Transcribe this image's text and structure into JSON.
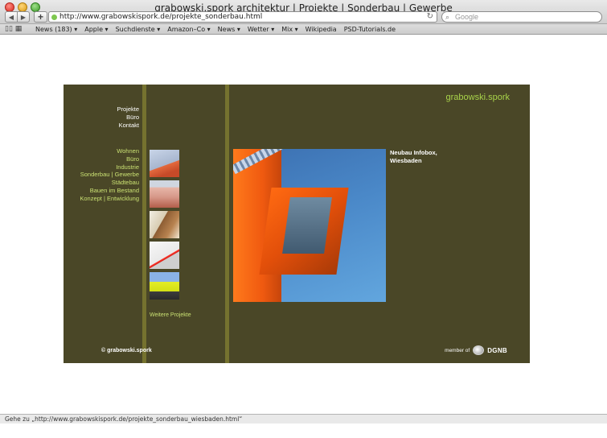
{
  "browser": {
    "window_title": "grabowski.spork architektur | Projekte | Sonderbau | Gewerbe",
    "url": "http://www.grabowskispork.de/projekte_sonderbau.html",
    "search_placeholder": "Google",
    "bookmarks": [
      "News (183) ▾",
      "Apple ▾",
      "Suchdienste ▾",
      "Amazon–Co ▾",
      "News ▾",
      "Wetter ▾",
      "Mix ▾",
      "Wikipedia",
      "PSD-Tutorials.de"
    ],
    "status_text": "Gehe zu „http://www.grabowskispork.de/projekte_sonderbau_wiesbaden.html“"
  },
  "site": {
    "logo": "grabowski.spork",
    "menu_main": [
      "Projekte",
      "Büro",
      "Kontakt"
    ],
    "menu_sub": [
      "Wohnen",
      "Büro",
      "Industrie",
      "Sonderbau | Gewerbe",
      "Städtebau",
      "Bauen im Bestand",
      "Konzept | Entwicklung"
    ],
    "more_projects": "Weitere Projekte",
    "caption_line1": "Neubau Infobox,",
    "caption_line2": "Wiesbaden",
    "copyright": "© grabowski.spork",
    "member_of": "member of",
    "dgnb": "DGNB",
    "colors": {
      "background": "#4a4727",
      "stripe": "#75722f",
      "accent": "#c9e072",
      "logo": "#a8d34a"
    }
  }
}
